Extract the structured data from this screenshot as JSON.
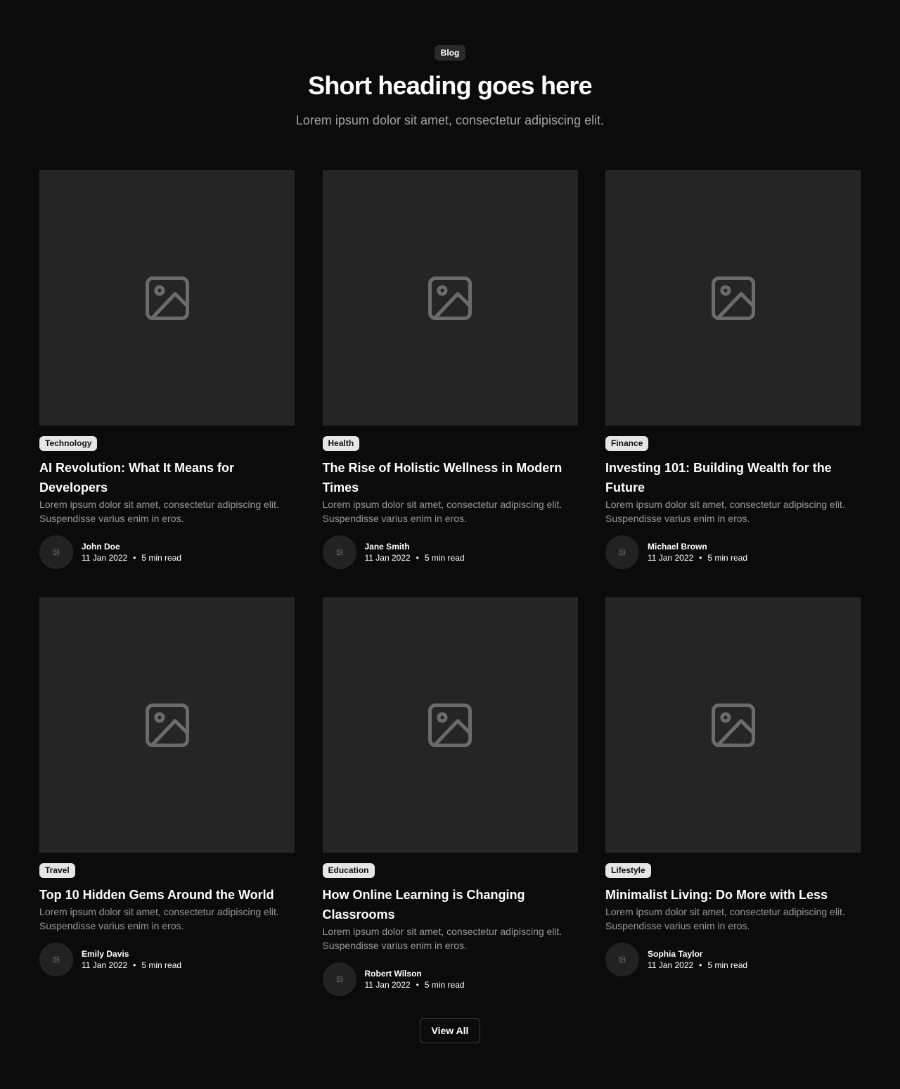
{
  "header": {
    "tagline": "Blog",
    "heading": "Short heading goes here",
    "subheading": "Lorem ipsum dolor sit amet, consectetur adipiscing elit."
  },
  "posts": [
    {
      "category": "Technology",
      "title": "AI Revolution: What It Means for Developers",
      "description": "Lorem ipsum dolor sit amet, consectetur adipiscing elit. Suspendisse varius enim in eros.",
      "author": "John Doe",
      "date": "11 Jan 2022",
      "read_time": "5 min read"
    },
    {
      "category": "Health",
      "title": "The Rise of Holistic Wellness in Modern Times",
      "description": "Lorem ipsum dolor sit amet, consectetur adipiscing elit. Suspendisse varius enim in eros.",
      "author": "Jane Smith",
      "date": "11 Jan 2022",
      "read_time": "5 min read"
    },
    {
      "category": "Finance",
      "title": "Investing 101: Building Wealth for the Future",
      "description": "Lorem ipsum dolor sit amet, consectetur adipiscing elit. Suspendisse varius enim in eros.",
      "author": "Michael Brown",
      "date": "11 Jan 2022",
      "read_time": "5 min read"
    },
    {
      "category": "Travel",
      "title": "Top 10 Hidden Gems Around the World",
      "description": "Lorem ipsum dolor sit amet, consectetur adipiscing elit. Suspendisse varius enim in eros.",
      "author": "Emily Davis",
      "date": "11 Jan 2022",
      "read_time": "5 min read"
    },
    {
      "category": "Education",
      "title": "How Online Learning is Changing Classrooms",
      "description": "Lorem ipsum dolor sit amet, consectetur adipiscing elit. Suspendisse varius enim in eros.",
      "author": "Robert Wilson",
      "date": "11 Jan 2022",
      "read_time": "5 min read"
    },
    {
      "category": "Lifestyle",
      "title": "Minimalist Living: Do More with Less",
      "description": "Lorem ipsum dolor sit amet, consectetur adipiscing elit. Suspendisse varius enim in eros.",
      "author": "Sophia Taylor",
      "date": "11 Jan 2022",
      "read_time": "5 min read"
    }
  ],
  "meta_separator": "•",
  "icons": {
    "thumbnail": "image-placeholder-icon",
    "avatar": "image-placeholder-icon"
  },
  "colors": {
    "background": "#0b0b0b",
    "card_image": "#252525",
    "badge_light": "#e6e6e6",
    "badge_dark": "#2a2a2a",
    "muted_text": "#9a9a9a"
  },
  "view_all_label": "View All"
}
